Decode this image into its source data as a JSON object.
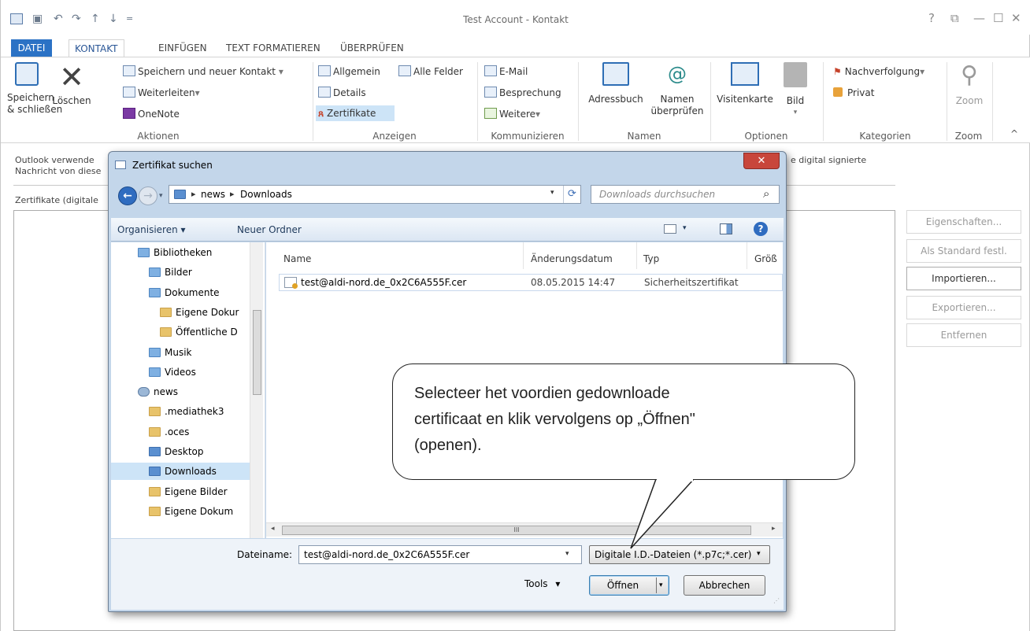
{
  "window": {
    "title": "Test Account - Kontakt",
    "help_glyph": "?",
    "restore_glyph": "⧉",
    "minimize_glyph": "—",
    "maximize_glyph": "☐",
    "close_glyph": "✕"
  },
  "quick_access": {
    "save_glyph": "▣",
    "undo_glyph": "↶",
    "redo_glyph": "↷",
    "up_glyph": "↑",
    "down_glyph": "↓",
    "customize_glyph": "="
  },
  "tabs": [
    "DATEI",
    "KONTAKT",
    "EINFÜGEN",
    "TEXT FORMATIEREN",
    "ÜBERPRÜFEN"
  ],
  "ribbon": {
    "aktionen": {
      "label": "Aktionen",
      "save_close": "Speichern\n& schließen",
      "delete": "Löschen",
      "save_new": "Speichern und neuer Kontakt",
      "forward": "Weiterleiten",
      "onenote": "OneNote"
    },
    "anzeigen": {
      "label": "Anzeigen",
      "general": "Allgemein",
      "all_fields": "Alle Felder",
      "details": "Details",
      "certificates": "Zertifikate"
    },
    "kommunizieren": {
      "label": "Kommunizieren",
      "email": "E-Mail",
      "meeting": "Besprechung",
      "more": "Weitere"
    },
    "namen": {
      "label": "Namen",
      "addressbook": "Adressbuch",
      "check_names": "Namen\nüberprüfen"
    },
    "optionen": {
      "label": "Optionen",
      "business_card": "Visitenkarte",
      "picture": "Bild"
    },
    "kategorien": {
      "label": "Kategorien",
      "followup": "Nachverfolgung",
      "private": "Privat"
    },
    "zoom": {
      "label": "Zoom",
      "zoom": "Zoom"
    },
    "collapse_glyph": "^",
    "dropdown_glyph": "▾"
  },
  "form": {
    "info_line1": "Outlook verwende",
    "info_line1_right": "e digital signierte",
    "info_line2": "Nachricht von diese",
    "certs_label": "Zertifikate (digitale",
    "side_buttons": [
      "Eigenschaften...",
      "Als Standard festl.",
      "Importieren...",
      "Exportieren...",
      "Entfernen"
    ]
  },
  "dialog": {
    "title": "Zertifikat suchen",
    "close_glyph": "✕",
    "breadcrumb": [
      "news",
      "Downloads"
    ],
    "breadcrumb_sep": "▸",
    "refresh_glyph": "⟳",
    "search_placeholder": "Downloads durchsuchen",
    "search_glyph": "⌕",
    "organize": "Organisieren",
    "new_folder": "Neuer Ordner",
    "help_glyph": "?",
    "nav_items": [
      {
        "label": "Bibliotheken",
        "indent": 0,
        "kind": "lib"
      },
      {
        "label": "Bilder",
        "indent": 1,
        "kind": "lib"
      },
      {
        "label": "Dokumente",
        "indent": 1,
        "kind": "lib"
      },
      {
        "label": "Eigene Dokur",
        "indent": 2,
        "kind": "folder"
      },
      {
        "label": "Öffentliche D",
        "indent": 2,
        "kind": "folder"
      },
      {
        "label": "Musik",
        "indent": 1,
        "kind": "lib"
      },
      {
        "label": "Videos",
        "indent": 1,
        "kind": "lib"
      },
      {
        "label": "news",
        "indent": 0,
        "kind": "user"
      },
      {
        "label": ".mediathek3",
        "indent": 1,
        "kind": "folder"
      },
      {
        "label": ".oces",
        "indent": 1,
        "kind": "folder"
      },
      {
        "label": "Desktop",
        "indent": 1,
        "kind": "blue"
      },
      {
        "label": "Downloads",
        "indent": 1,
        "kind": "blue",
        "selected": true
      },
      {
        "label": "Eigene Bilder",
        "indent": 1,
        "kind": "folder"
      },
      {
        "label": "Eigene Dokum",
        "indent": 1,
        "kind": "folder"
      }
    ],
    "columns": [
      "Name",
      "Änderungsdatum",
      "Typ",
      "Größ"
    ],
    "files": [
      {
        "name": "test@aldi-nord.de_0x2C6A555F.cer",
        "date": "08.05.2015 14:47",
        "type": "Sicherheitszertifikat"
      }
    ],
    "hscroll_thumb": "III",
    "filename_label": "Dateiname:",
    "filename_value": "test@aldi-nord.de_0x2C6A555F.cer",
    "filetype_value": "Digitale I.D.-Dateien (*.p7c;*.cer)",
    "tools": "Tools",
    "open": "Öffnen",
    "cancel": "Abbrechen"
  },
  "callout": {
    "line1": "Selecteer het voordien gedownloade",
    "line2": "certificaat en klik vervolgens op „Öffnen\"",
    "line3": "(openen)."
  },
  "colors": {
    "file_tab": "#2b72c5",
    "selection": "#cde4f7",
    "dialog_frame": "#c3d6ea",
    "close_red": "#c8463b"
  }
}
